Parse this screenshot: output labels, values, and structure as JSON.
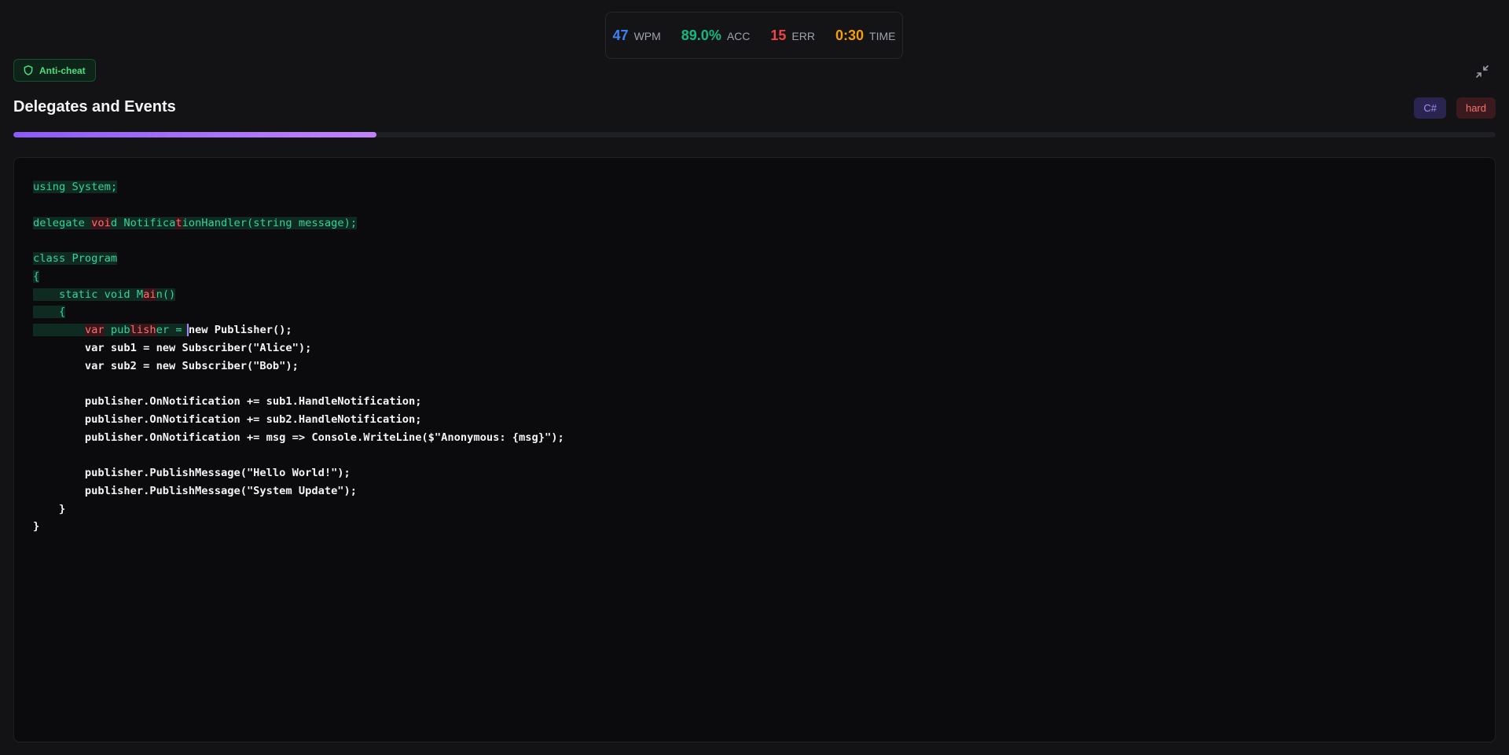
{
  "stats": {
    "wpm": {
      "value": "47",
      "label": "WPM",
      "color": "#3b82f6"
    },
    "acc": {
      "value": "89.0%",
      "label": "ACC",
      "color": "#10b981"
    },
    "err": {
      "value": "15",
      "label": "ERR",
      "color": "#ef4444"
    },
    "time": {
      "value": "0:30",
      "label": "TIME",
      "color": "#f59e0b"
    }
  },
  "anticheat_label": "Anti-cheat",
  "title": "Delegates and Events",
  "badges": {
    "language": "C#",
    "difficulty": "hard"
  },
  "progress": {
    "fraction": 0.245
  },
  "icons": {
    "shield": "shield-icon",
    "collapse": "collapse-icon"
  },
  "code": {
    "lines": [
      {
        "segments": [
          {
            "t": "using System;",
            "s": "ok"
          }
        ]
      },
      {
        "segments": []
      },
      {
        "segments": [
          {
            "t": "delegate ",
            "s": "ok"
          },
          {
            "t": "voi",
            "s": "err"
          },
          {
            "t": "d Notifica",
            "s": "ok"
          },
          {
            "t": "t",
            "s": "err"
          },
          {
            "t": "ionHandler(string message);",
            "s": "ok"
          }
        ]
      },
      {
        "segments": []
      },
      {
        "segments": [
          {
            "t": "class Program",
            "s": "ok"
          }
        ]
      },
      {
        "segments": [
          {
            "t": "{",
            "s": "ok"
          }
        ]
      },
      {
        "segments": [
          {
            "t": "    static void M",
            "s": "ok"
          },
          {
            "t": "ai",
            "s": "err"
          },
          {
            "t": "n()",
            "s": "ok"
          }
        ]
      },
      {
        "segments": [
          {
            "t": "    {",
            "s": "ok"
          }
        ]
      },
      {
        "segments": [
          {
            "t": "        ",
            "s": "ok"
          },
          {
            "t": "var",
            "s": "err"
          },
          {
            "t": " pub",
            "s": "ok"
          },
          {
            "t": "lish",
            "s": "err"
          },
          {
            "t": "er = ",
            "s": "ok"
          },
          {
            "t": "new Publisher();",
            "s": "pending",
            "cursor": true
          }
        ]
      },
      {
        "segments": [
          {
            "t": "        var sub1 = new Subscriber(\"Alice\");",
            "s": "pending"
          }
        ]
      },
      {
        "segments": [
          {
            "t": "        var sub2 = new Subscriber(\"Bob\");",
            "s": "pending"
          }
        ]
      },
      {
        "segments": []
      },
      {
        "segments": [
          {
            "t": "        publisher.OnNotification += sub1.HandleNotification;",
            "s": "pending"
          }
        ]
      },
      {
        "segments": [
          {
            "t": "        publisher.OnNotification += sub2.HandleNotification;",
            "s": "pending"
          }
        ]
      },
      {
        "segments": [
          {
            "t": "        publisher.OnNotification += msg => Console.WriteLine($\"Anonymous: {msg}\");",
            "s": "pending"
          }
        ]
      },
      {
        "segments": []
      },
      {
        "segments": [
          {
            "t": "        publisher.PublishMessage(\"Hello World!\");",
            "s": "pending"
          }
        ]
      },
      {
        "segments": [
          {
            "t": "        publisher.PublishMessage(\"System Update\");",
            "s": "pending"
          }
        ]
      },
      {
        "segments": [
          {
            "t": "    }",
            "s": "pending"
          }
        ]
      },
      {
        "segments": [
          {
            "t": "}",
            "s": "pending"
          }
        ]
      }
    ]
  }
}
